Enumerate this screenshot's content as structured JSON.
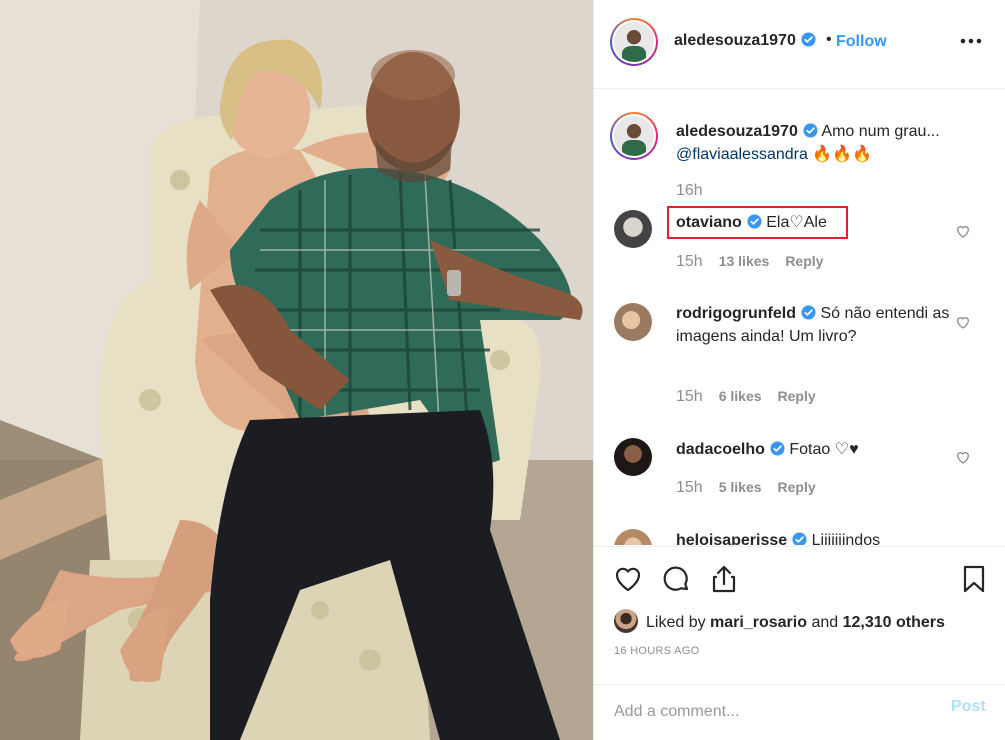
{
  "post": {
    "author": "aledesouza1970",
    "follow_label": "Follow",
    "separator": "•",
    "caption_text": "Amo num grau...",
    "caption_mention": "@flaviaalessandra",
    "caption_emoji": "🔥🔥🔥",
    "caption_time": "16h"
  },
  "comments": [
    {
      "username": "otaviano",
      "text": "Ela♡Ale",
      "time": "15h",
      "likes": "13 likes",
      "reply": "Reply",
      "highlighted": true
    },
    {
      "username": "rodrigogrunfeld",
      "text": "Só não entendi as imagens ainda! Um livro?",
      "time": "15h",
      "likes": "6 likes",
      "reply": "Reply"
    },
    {
      "username": "dadacoelho",
      "text": "Fotao ♡♥",
      "time": "15h",
      "likes": "5 likes",
      "reply": "Reply"
    },
    {
      "username": "heloisaperisse",
      "text": "Liiiiiiindos"
    }
  ],
  "actions": {
    "liked_prefix": "Liked by",
    "liked_user": "mari_rosario",
    "liked_mid": "and",
    "liked_count": "12,310 others",
    "time_ago": "16 HOURS AGO"
  },
  "add_comment": {
    "placeholder": "Add a comment...",
    "post_label": "Post"
  },
  "colors": {
    "accent": "#3897f0",
    "verified": "#3897f0",
    "highlight_box": "#e0202a",
    "muted": "#8e8e8e",
    "post_disabled": "#b2dffc"
  },
  "icons": {
    "more": "more-horizontal-icon",
    "like": "heart-outline-icon",
    "comment": "comment-bubble-icon",
    "share": "share-upload-icon",
    "save": "bookmark-icon",
    "verified": "verified-badge-icon"
  }
}
